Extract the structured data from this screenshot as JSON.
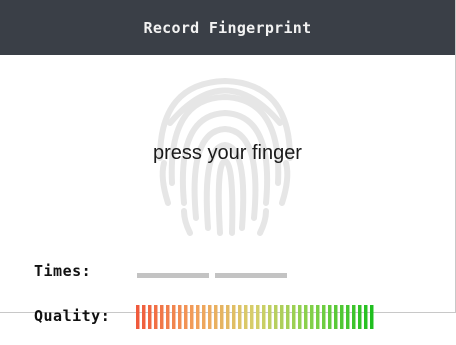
{
  "dialog": {
    "title": "Record Fingerprint",
    "prompt": "press your finger"
  },
  "times": {
    "label": "Times:",
    "total": 2,
    "completed": 0,
    "inactive_color": "#c3c3c3"
  },
  "quality": {
    "label": "Quality:",
    "segment_count": 40,
    "level": 1.0,
    "gradient_colors": [
      "#f05a3c",
      "#f2a05a",
      "#d6cf6a",
      "#7fd048",
      "#1fbf1f"
    ]
  },
  "icons": {
    "background": "fingerprint-icon"
  }
}
